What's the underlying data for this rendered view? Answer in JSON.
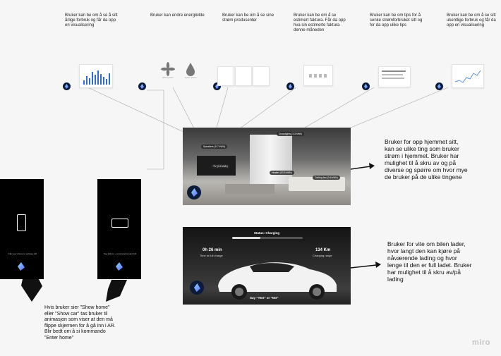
{
  "top_notes": [
    "Bruker kan be om å se å sitt årlige forbruk og får da opp en visualisering",
    "Bruker kan endre energikilde",
    "Bruker kan be om å se sine strøm produsenter",
    "Bruker kan be om å se estimert faktura. Får da opp hva sin estimerte faktura denne måneden",
    "Bruker kan be om tips for å senke strømforbruket sitt og for da opp ulike tips",
    "Bruker kan be om å se sitt ukentlige forbruk og får da opp en visualisering"
  ],
  "energy_sources": {
    "wind": "Wind power",
    "hydro": "Hydro power"
  },
  "home_tags": [
    "Downlights (3.3 kWh)",
    "Speakers (0.7 kWh)",
    "TV (0.5 kWh)",
    "Heater (20.5 kWh)",
    "Ceiling fan (3.6 kWh)"
  ],
  "car": {
    "status": "Status: Charging",
    "time_value": "0h 26 min",
    "time_label": "Time to full charge",
    "range_value": "134 Km",
    "range_label": "Charging range",
    "prompt": "Say \"YES\" or \"NO\""
  },
  "phones": {
    "left_caption": "Flip your phone to activate AR",
    "right_caption": "Say Ellinor + command to start AR"
  },
  "right_notes": {
    "home": "Bruker for opp hjemmet sitt, kan se ulike ting som bruker strøm i hjemmet. Bruker har mulighet til å skru av og på diverse og spørre om hvor mye de bruker på de ulike tingene",
    "car": "Bruker for vite om bilen lader, hvor langt den kan kjøre på nåværende lading og hvor lenge til den er full ladet. Bruker har mulighet til å skru av/på lading"
  },
  "bottom_note": "Hvis bruker sier \"Show home\" eller \"Show car\" tas bruker til animasjon som viser at den må flippe skjermen for å gå inn i AR. Blir bedt om å si kommando \"Enter home\"",
  "watermark": "miro"
}
